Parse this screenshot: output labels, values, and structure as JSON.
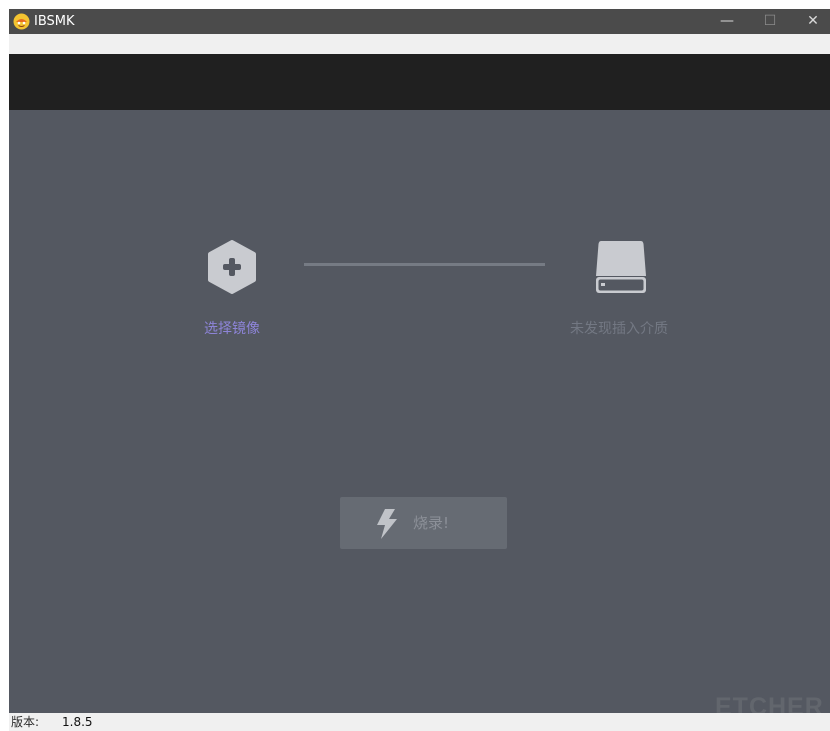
{
  "window": {
    "title": "IBSMK",
    "controls": {
      "minimize": "—",
      "maximize": "☐",
      "close": "✕"
    },
    "app_icon": "app-logo-icon"
  },
  "main": {
    "select_step": {
      "label": "选择镜像",
      "icon": "plus-hexagon-icon",
      "color": "#8d84d8"
    },
    "drive_step": {
      "label": "未发现插入介质",
      "icon": "drive-icon"
    },
    "flash_button": {
      "label": "烧录!",
      "icon": "lightning-icon"
    },
    "brand": "ETCHER"
  },
  "status": {
    "version_label": "版本:",
    "version": "1.8.5"
  },
  "colors": {
    "titlebar": "#4b4b4b",
    "header": "#202020",
    "main_background": "#545861",
    "button_background": "#666b73"
  }
}
